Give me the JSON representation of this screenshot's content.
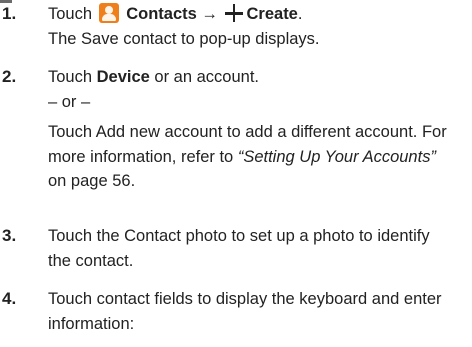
{
  "steps": [
    {
      "number": "1.",
      "line1": {
        "t1": "Touch",
        "b1": "Contacts",
        "arrow": "→",
        "b2": "Create",
        "end": "."
      },
      "line2": "The Save contact to pop-up displays."
    },
    {
      "number": "2.",
      "line1": {
        "t1": "Touch ",
        "b1": "Device",
        "t2": " or an account."
      },
      "or_text": "– or –",
      "para": {
        "l1": "Touch Add new account to add a different account. For",
        "l2a": "more information, refer to ",
        "l2i": "“Setting Up Your Accounts”",
        "l3": "on page 56."
      }
    },
    {
      "number": "3.",
      "l1": "Touch the Contact photo to set up a photo to identify",
      "l2": "the contact."
    },
    {
      "number": "4.",
      "l1": "Touch contact fields to display the keyboard and enter",
      "l2": "information:"
    }
  ],
  "icons": {
    "contacts": "contacts-app-icon",
    "create": "plus-icon",
    "arrow": "right-arrow"
  },
  "colors": {
    "contacts_icon": "#ef7f1a"
  }
}
